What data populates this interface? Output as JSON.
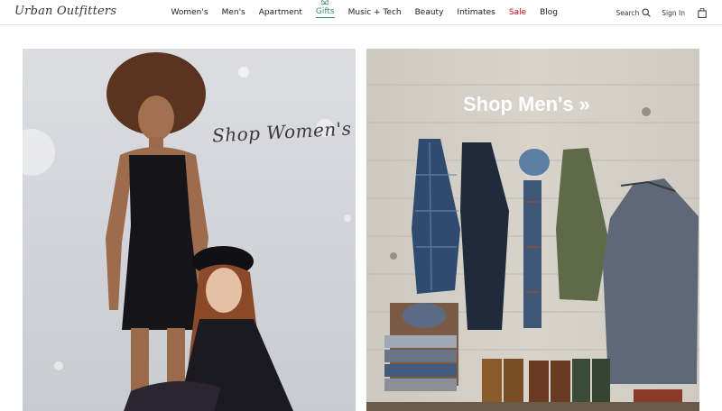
{
  "brand": {
    "logo_text": "Urban Outfitters"
  },
  "nav": {
    "items": [
      {
        "label": "Women's",
        "id": "womens"
      },
      {
        "label": "Men's",
        "id": "mens"
      },
      {
        "label": "Apartment",
        "id": "apartment"
      },
      {
        "label": "Gifts",
        "id": "gifts"
      },
      {
        "label": "Music + Tech",
        "id": "music-tech"
      },
      {
        "label": "Beauty",
        "id": "beauty"
      },
      {
        "label": "Intimates",
        "id": "intimates"
      },
      {
        "label": "Sale",
        "id": "sale"
      },
      {
        "label": "Blog",
        "id": "blog"
      }
    ]
  },
  "header_right": {
    "search_label": "Search",
    "signin_label": "Sign In",
    "bag_icon": "shopping-bag-icon"
  },
  "hero": {
    "women_cta": "Shop Women's »",
    "men_cta": "Shop Men's »"
  },
  "colors": {
    "sale": "#d0021b",
    "gifts": "#3d8a70",
    "divider": "#e4e4e4"
  }
}
